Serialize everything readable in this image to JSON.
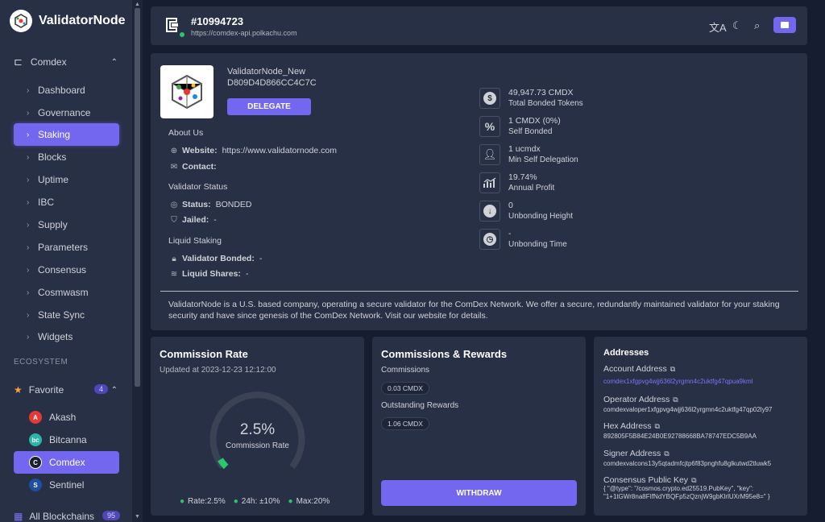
{
  "brand": {
    "name": "ValidatorNode"
  },
  "sidebar": {
    "group": "Comdex",
    "items": [
      {
        "label": "Dashboard"
      },
      {
        "label": "Governance"
      },
      {
        "label": "Staking"
      },
      {
        "label": "Blocks"
      },
      {
        "label": "Uptime"
      },
      {
        "label": "IBC"
      },
      {
        "label": "Supply"
      },
      {
        "label": "Parameters"
      },
      {
        "label": "Consensus"
      },
      {
        "label": "Cosmwasm"
      },
      {
        "label": "State Sync"
      },
      {
        "label": "Widgets"
      }
    ],
    "active_item": "Staking",
    "ecosystem_title": "ECOSYSTEM",
    "favorite": {
      "label": "Favorite",
      "count": "4"
    },
    "chains": [
      {
        "label": "Akash",
        "color": "#e53935"
      },
      {
        "label": "Bitcanna",
        "color": "#29b6a8"
      },
      {
        "label": "Comdex",
        "color": "#1a1f2e"
      },
      {
        "label": "Sentinel",
        "color": "#1e4fa3"
      }
    ],
    "all_blockchains": {
      "label": "All Blockchains",
      "count": "95"
    }
  },
  "topbar": {
    "height": "#10994723",
    "url": "https://comdex-api.polkachu.com"
  },
  "validator": {
    "moniker": "ValidatorNode_New",
    "hex": "D809D4D866CC4C7C",
    "delegate_label": "DELEGATE",
    "about_title": "About Us",
    "website_label": "Website:",
    "website": "https://www.validatornode.com",
    "contact_label": "Contact:",
    "status_title": "Validator Status",
    "status_label": "Status:",
    "status": "BONDED",
    "jailed_label": "Jailed:",
    "jailed": "-",
    "liquid_title": "Liquid Staking",
    "vbonded_label": "Validator Bonded:",
    "vbonded": "-",
    "lshares_label": "Liquid Shares:",
    "lshares": "-",
    "description": "ValidatorNode is a U.S. based company, operating a secure validator for the ComDex Network. We offer a secure, redundantly maintained validator for your staking security and have since genesis of the ComDex Network. Visit our website for details."
  },
  "stats": [
    {
      "value": "49,947.73 CMDX",
      "label": "Total Bonded Tokens",
      "icon": "dollar-icon"
    },
    {
      "value": "1 CMDX (0%)",
      "label": "Self Bonded",
      "icon": "percent-icon"
    },
    {
      "value": "1 ucmdx",
      "label": "Min Self Delegation",
      "icon": "user-icon"
    },
    {
      "value": "19.74%",
      "label": "Annual Profit",
      "icon": "trend-icon"
    },
    {
      "value": "0",
      "label": "Unbonding Height",
      "icon": "arrow-down-icon"
    },
    {
      "value": "-",
      "label": "Unbonding Time",
      "icon": "clock-icon"
    }
  ],
  "commission": {
    "title": "Commission Rate",
    "updated": "Updated at 2023-12-23 12:12:00",
    "value": "2.5%",
    "label": "Commission Rate",
    "rate_fraction": 0.025,
    "rate": "Rate:2.5%",
    "h24": "24h: ±10%",
    "max": "Max:20%",
    "accent": "#28c76f"
  },
  "rewards": {
    "title": "Commissions & Rewards",
    "commissions_label": "Commissions",
    "commissions": "0.03 CMDX",
    "outstanding_label": "Outstanding Rewards",
    "outstanding": "1.06 CMDX",
    "withdraw_label": "WITHDRAW"
  },
  "addresses": {
    "title": "Addresses",
    "account_label": "Account Address",
    "account": "comdex1xfgpvg4wjj636l2yrgmn4c2uktfg47qpua9kml",
    "operator_label": "Operator Address",
    "operator": "comdexvaloper1xfgpvg4wjj636l2yrgmn4c2uktfg47qp02ly97",
    "hex_label": "Hex Address",
    "hex": "892805F5B84E24B0E92788668BA78747EDC5B9AA",
    "signer_label": "Signer Address",
    "signer": "comdexvalcons13y5qtadmfcjtp6f83pnghfu8glkutwd2tluwk5",
    "pubkey_label": "Consensus Public Key",
    "pubkey": "{ \"@type\": \"/cosmos.crypto.ed25519.PubKey\", \"key\": \"1+1tGWr8na8FIfNdYBQFp5zQznjW9gbKlrlUXrM95e8=\" }"
  },
  "colors": {
    "accent": "#7367f0",
    "bg": "#161d31",
    "card": "#283046",
    "success": "#28c76f"
  }
}
